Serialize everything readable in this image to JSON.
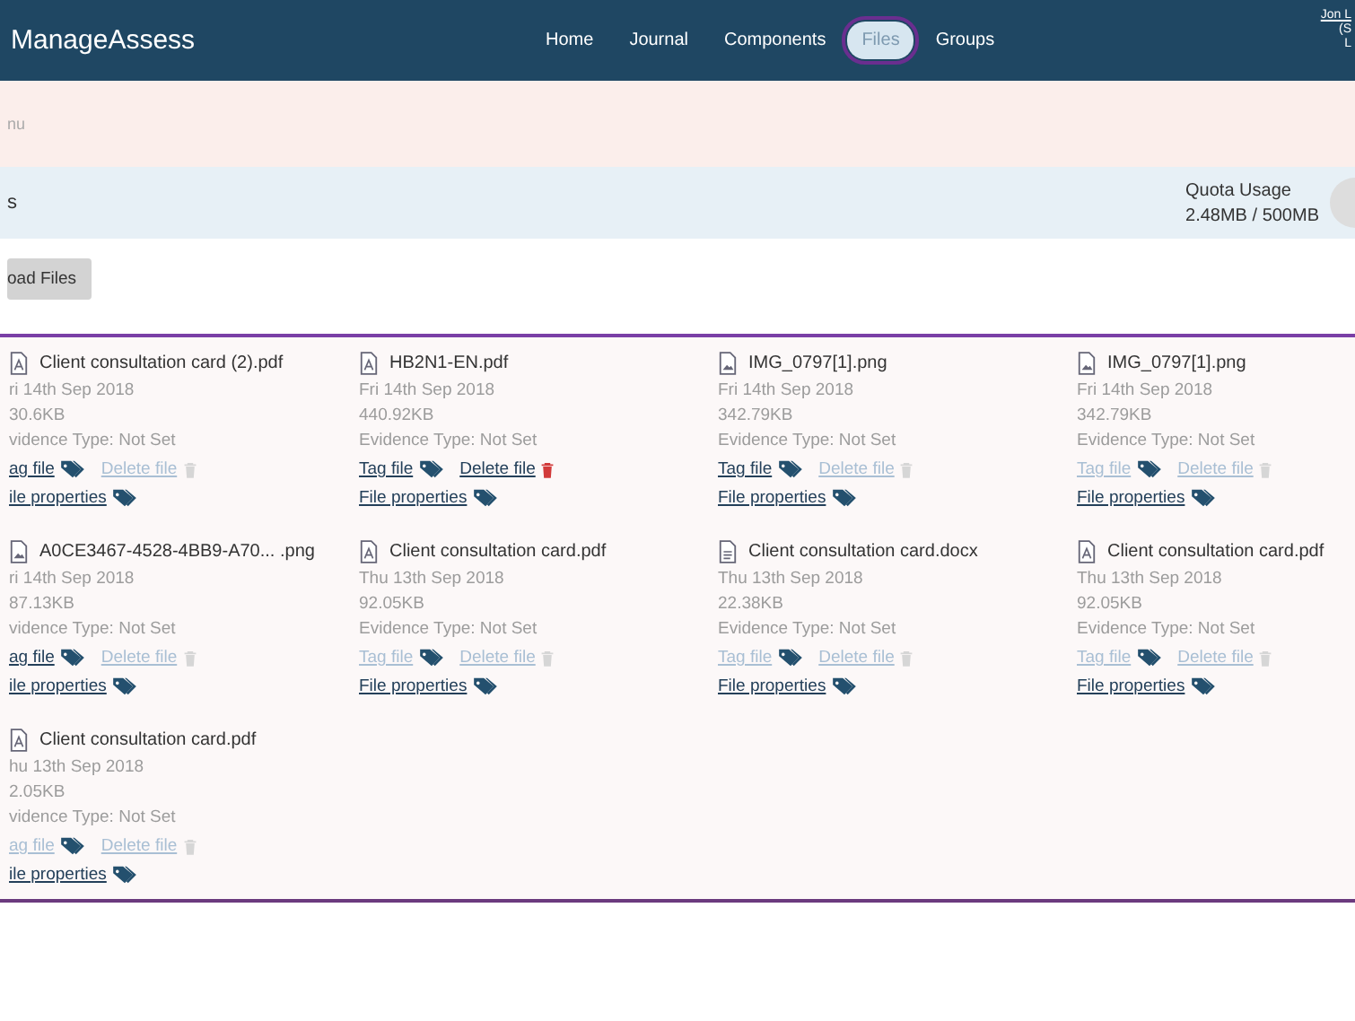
{
  "navbar": {
    "brand": "ManageAssess",
    "links": [
      {
        "label": "Home",
        "selected": false
      },
      {
        "label": "Journal",
        "selected": false
      },
      {
        "label": "Components",
        "selected": false
      },
      {
        "label": "Files",
        "selected": true
      },
      {
        "label": "Groups",
        "selected": false
      }
    ],
    "user": [
      "Jon L",
      "(S",
      "L"
    ]
  },
  "menu_bar": {
    "label": "nu"
  },
  "header": {
    "title": "s",
    "quota_label": "Quota Usage",
    "quota_value": "2.48MB / 500MB"
  },
  "upload_button": "oad Files",
  "files": [
    {
      "kind": "pdf",
      "name": "Client consultation card (2).pdf",
      "date": "ri 14th Sep 2018",
      "size": "30.6KB",
      "evidence": "vidence Type: Not Set",
      "tag_label": "ag file",
      "tag_enabled": true,
      "delete_label": "Delete file",
      "delete_enabled": false,
      "properties_label": "ile properties"
    },
    {
      "kind": "pdf",
      "name": "HB2N1-EN.pdf",
      "date": "Fri 14th Sep 2018",
      "size": "440.92KB",
      "evidence": "Evidence Type: Not Set",
      "tag_label": "Tag file",
      "tag_enabled": true,
      "delete_label": "Delete file",
      "delete_enabled": true,
      "properties_label": "File properties"
    },
    {
      "kind": "image",
      "name": "IMG_0797[1].png",
      "date": "Fri 14th Sep 2018",
      "size": "342.79KB",
      "evidence": "Evidence Type: Not Set",
      "tag_label": "Tag file",
      "tag_enabled": true,
      "delete_label": "Delete file",
      "delete_enabled": false,
      "properties_label": "File properties"
    },
    {
      "kind": "image",
      "name": "IMG_0797[1].png",
      "date": "Fri 14th Sep 2018",
      "size": "342.79KB",
      "evidence": "Evidence Type: Not Set",
      "tag_label": "Tag file",
      "tag_enabled": false,
      "delete_label": "Delete file",
      "delete_enabled": false,
      "properties_label": "File properties"
    },
    {
      "kind": "image",
      "name": "A0CE3467-4528-4BB9-A70... .png",
      "date": "ri 14th Sep 2018",
      "size": "87.13KB",
      "evidence": "vidence Type: Not Set",
      "tag_label": "ag file",
      "tag_enabled": true,
      "delete_label": "Delete file",
      "delete_enabled": false,
      "properties_label": "ile properties"
    },
    {
      "kind": "pdf",
      "name": "Client consultation card.pdf",
      "date": "Thu 13th Sep 2018",
      "size": "92.05KB",
      "evidence": "Evidence Type: Not Set",
      "tag_label": "Tag file",
      "tag_enabled": false,
      "delete_label": "Delete file",
      "delete_enabled": false,
      "properties_label": "File properties"
    },
    {
      "kind": "doc",
      "name": "Client consultation card.docx",
      "date": "Thu 13th Sep 2018",
      "size": "22.38KB",
      "evidence": "Evidence Type: Not Set",
      "tag_label": "Tag file",
      "tag_enabled": false,
      "delete_label": "Delete file",
      "delete_enabled": false,
      "properties_label": "File properties"
    },
    {
      "kind": "pdf",
      "name": "Client consultation card.pdf",
      "date": "Thu 13th Sep 2018",
      "size": "92.05KB",
      "evidence": "Evidence Type: Not Set",
      "tag_label": "Tag file",
      "tag_enabled": false,
      "delete_label": "Delete file",
      "delete_enabled": false,
      "properties_label": "File properties"
    },
    {
      "kind": "pdf",
      "name": "Client consultation card.pdf",
      "date": "hu 13th Sep 2018",
      "size": "2.05KB",
      "evidence": "vidence Type: Not Set",
      "tag_label": "ag file",
      "tag_enabled": false,
      "delete_label": "Delete file",
      "delete_enabled": false,
      "properties_label": "ile properties"
    }
  ]
}
